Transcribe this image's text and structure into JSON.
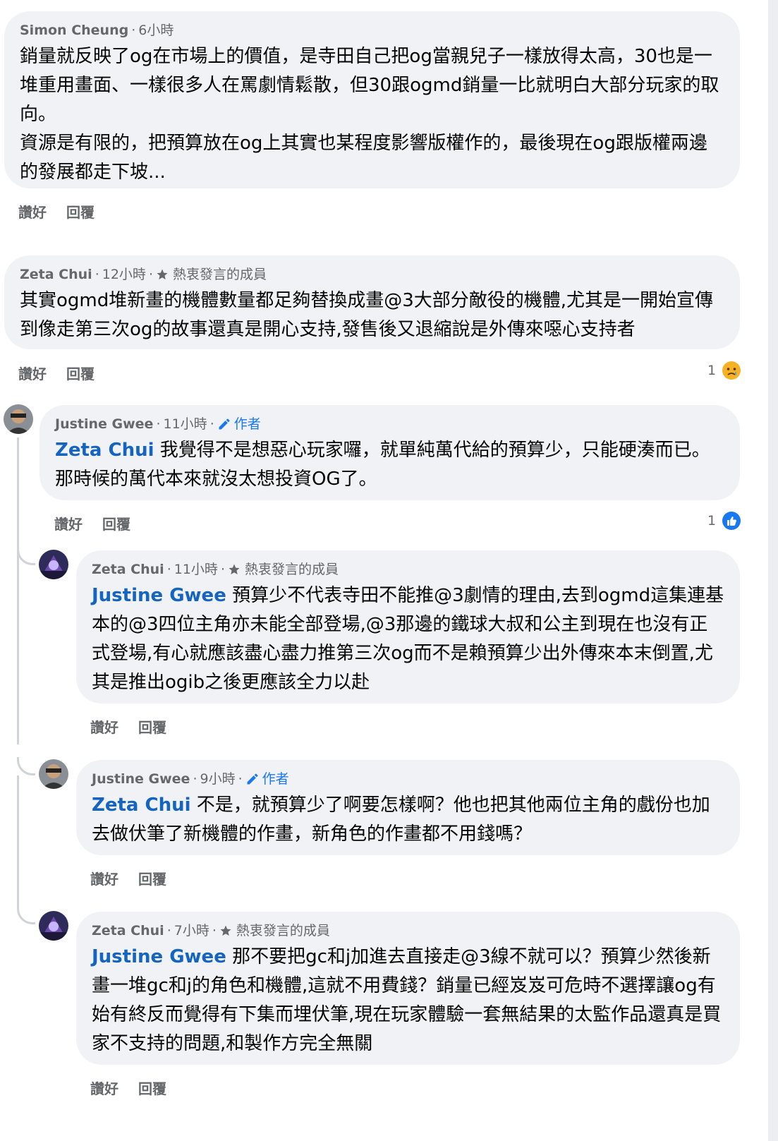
{
  "comments": [
    {
      "name": "Simon Cheung",
      "time": "6小時",
      "paragraphs": [
        "銷量就反映了og在市場上的價值，是寺田自己把og當親兒子一樣放得太高，30也是一堆重用畫面、一樣很多人在罵劇情鬆散，但30跟ogmd銷量一比就明白大部分玩家的取向。",
        "資源是有限的，把預算放在og上其實也某程度影響版權作的，最後現在og跟版權兩邊的發展都走下坡..."
      ],
      "like": "讚好",
      "reply": "回覆"
    },
    {
      "name": "Zeta Chui",
      "time": "12小時",
      "badge": "熱衷發言的成員",
      "text": "其實ogmd堆新畫的機體數量都足夠替換成畫@3大部分敵役的機體,尤其是一開始宣傳到像走第三次og的故事還真是開心支持,發售後又退縮說是外傳來噁心支持者",
      "like": "讚好",
      "reply": "回覆",
      "reaction_count": "1"
    },
    {
      "name": "Justine Gwee",
      "time": "11小時",
      "author": "作者",
      "mention": "Zeta Chui",
      "text": " 我覺得不是想惡心玩家囉，就單純萬代給的預算少，只能硬湊而已。那時候的萬代本來就沒太想投資OG了。",
      "like": "讚好",
      "reply": "回覆",
      "reaction_count": "1"
    },
    {
      "name": "Zeta Chui",
      "time": "11小時",
      "badge": "熱衷發言的成員",
      "mention": "Justine Gwee",
      "text": " 預算少不代表寺田不能推@3劇情的理由,去到ogmd這集連基本的@3四位主角亦未能全部登場,@3那邊的鐵球大叔和公主到現在也沒有正式登場,有心就應該盡心盡力推第三次og而不是賴預算少出外傳來本末倒置,尤其是推出ogib之後更應該全力以赴",
      "like": "讚好",
      "reply": "回覆"
    },
    {
      "name": "Justine Gwee",
      "time": "9小時",
      "author": "作者",
      "mention": "Zeta Chui",
      "text": " 不是，就預算少了啊要怎樣啊？他也把其他兩位主角的戲份也加去做伏筆了新機體的作畫，新角色的作畫都不用錢嗎？",
      "like": "讚好",
      "reply": "回覆"
    },
    {
      "name": "Zeta Chui",
      "time": "7小時",
      "badge": "熱衷發言的成員",
      "mention": "Justine Gwee",
      "text": " 那不要把gc和j加進去直接走@3線不就可以？預算少然後新畫一堆gc和j的角色和機體,這就不用費錢？銷量已經岌岌可危時不選擇讓og有始有終反而覺得有下集而埋伏筆,現在玩家體驗一套無結果的太監作品還真是買家不支持的問題,和製作方完全無關",
      "like": "讚好",
      "reply": "回覆"
    }
  ],
  "separator": "·",
  "colors": {
    "mention": "#1565c0",
    "author": "#1877f2",
    "bubble": "#f0f2f5",
    "meta": "#65676b"
  },
  "icons": {
    "author": "pencil-icon",
    "badge": "star-icon",
    "haha_sad": "sad-face-icon",
    "like": "thumbs-up-icon"
  }
}
